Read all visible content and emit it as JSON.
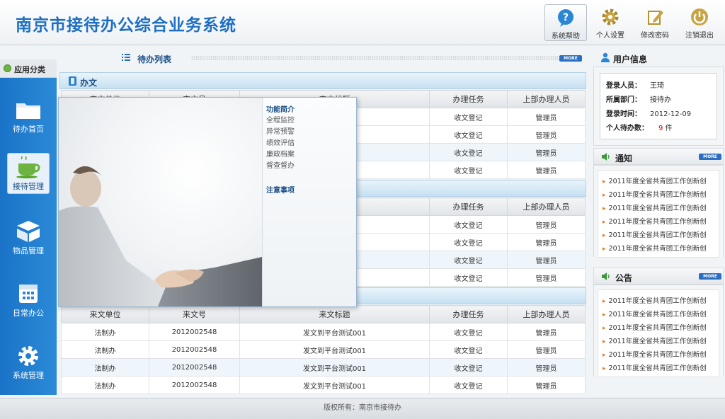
{
  "app": {
    "title": "南京市接待办公综合业务系统"
  },
  "toolbar": [
    {
      "label": "系统帮助",
      "icon": "help-icon"
    },
    {
      "label": "个人设置",
      "icon": "gear-icon"
    },
    {
      "label": "修改密码",
      "icon": "edit-icon"
    },
    {
      "label": "注销退出",
      "icon": "power-icon"
    }
  ],
  "sidebar": {
    "header": "应用分类",
    "items": [
      {
        "label": "待办首页",
        "icon": "folder-icon"
      },
      {
        "label": "接待管理",
        "icon": "cup-icon",
        "active": true
      },
      {
        "label": "物品管理",
        "icon": "box-icon"
      },
      {
        "label": "日常办公",
        "icon": "calendar-icon"
      },
      {
        "label": "系统管理",
        "icon": "gear-icon"
      }
    ]
  },
  "main": {
    "list_title": "待办列表",
    "more": "MORE",
    "section1_title": "办文",
    "columns": [
      "来文单位",
      "来文号",
      "来文标题",
      "办理任务",
      "上部办理人员"
    ],
    "table1_rows": [
      [
        "收文登记",
        "管理员"
      ],
      [
        "收文登记",
        "管理员"
      ],
      [
        "收文登记",
        "管理员"
      ],
      [
        "收文登记",
        "管理员"
      ]
    ],
    "table2_rows": [
      [
        "收文登记",
        "管理员"
      ],
      [
        "收文登记",
        "管理员"
      ],
      [
        "收文登记",
        "管理员"
      ],
      [
        "收文登记",
        "管理员"
      ]
    ],
    "table3_rows": [
      [
        "法制办",
        "2012002548",
        "发文到平台测试001",
        "收文登记",
        "管理员"
      ],
      [
        "法制办",
        "2012002548",
        "发文到平台测试001",
        "收文登记",
        "管理员"
      ],
      [
        "法制办",
        "2012002548",
        "发文到平台测试001",
        "收文登记",
        "管理员"
      ],
      [
        "法制办",
        "2012002548",
        "发文到平台测试001",
        "收文登记",
        "管理员"
      ]
    ]
  },
  "popup": {
    "heading1": "功能简介",
    "items": [
      "全程监控",
      "异常预警",
      "绩效评估",
      "廉政档案",
      "督查督办"
    ],
    "heading2": "注意事项"
  },
  "user_info": {
    "title": "用户信息",
    "rows": [
      {
        "key": "登录人员：",
        "value": "王琦"
      },
      {
        "key": "所属部门：",
        "value": "接待办"
      },
      {
        "key": "登录时间：",
        "value": "2012-12-09"
      },
      {
        "key": "个人待办数：",
        "value": "9",
        "unit": " 件"
      }
    ]
  },
  "notice": {
    "title": "通知",
    "items": [
      "2011年度全省共青团工作创新创",
      "2011年度全省共青团工作创新创",
      "2011年度全省共青团工作创新创",
      "2011年度全省共青团工作创新创",
      "2011年度全省共青团工作创新创",
      "2011年度全省共青团工作创新创"
    ]
  },
  "announce": {
    "title": "公告",
    "items": [
      "2011年度全省共青团工作创新创",
      "2011年度全省共青团工作创新创",
      "2011年度全省共青团工作创新创",
      "2011年度全省共青团工作创新创",
      "2011年度全省共青团工作创新创",
      "2011年度全省共青团工作创新创"
    ]
  },
  "footer": {
    "text": "版权所有：南京市接待办"
  },
  "colors": {
    "brand": "#1d6fc4",
    "sidebar": "#1a73c7",
    "accent_red": "#d60000"
  }
}
